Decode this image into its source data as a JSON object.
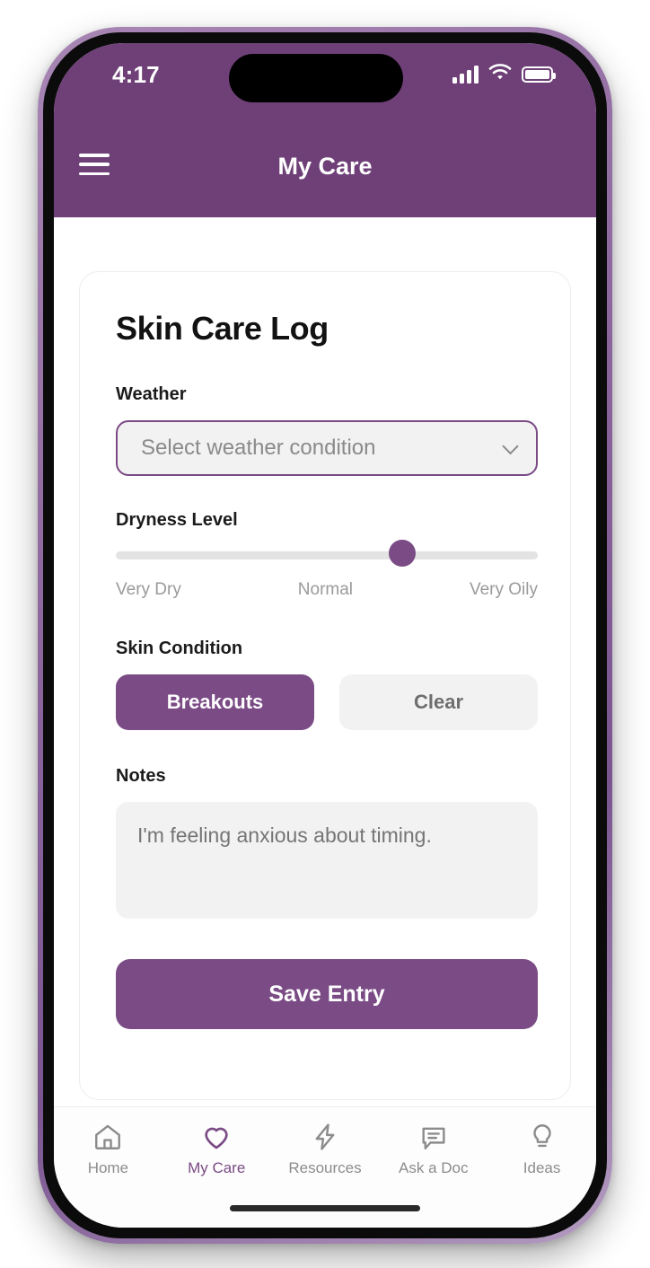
{
  "status_bar": {
    "time": "4:17",
    "signal_icon": "signal-bars-icon",
    "wifi_icon": "wifi-icon",
    "battery_icon": "battery-icon"
  },
  "header": {
    "menu_icon": "hamburger-menu-icon",
    "title": "My Care"
  },
  "card": {
    "title": "Skin Care Log",
    "weather": {
      "label": "Weather",
      "placeholder": "Select weather condition",
      "value": "",
      "chevron_icon": "chevron-down-icon"
    },
    "dryness": {
      "label": "Dryness Level",
      "value_percent": 69,
      "min_label": "Very Dry",
      "mid_label": "Normal",
      "max_label": "Very Oily"
    },
    "skin_condition": {
      "label": "Skin Condition",
      "options": [
        {
          "label": "Breakouts",
          "selected": true
        },
        {
          "label": "Clear",
          "selected": false
        }
      ]
    },
    "notes": {
      "label": "Notes",
      "value": "I'm feeling anxious about timing.",
      "placeholder": "I'm feeling anxious about timing."
    },
    "save_label": "Save Entry"
  },
  "bottom_nav": [
    {
      "label": "Home",
      "icon": "home-icon",
      "active": false
    },
    {
      "label": "My Care",
      "icon": "heart-icon",
      "active": true
    },
    {
      "label": "Resources",
      "icon": "lightning-bolt-icon",
      "active": false
    },
    {
      "label": "Ask a Doc",
      "icon": "chat-bubble-icon",
      "active": false
    },
    {
      "label": "Ideas",
      "icon": "lightbulb-icon",
      "active": false
    }
  ],
  "colors": {
    "brand_purple": "#6f4078",
    "accent_purple": "#7a4b85",
    "field_gray": "#f3f2f3",
    "muted_text": "#8a8a8a"
  }
}
